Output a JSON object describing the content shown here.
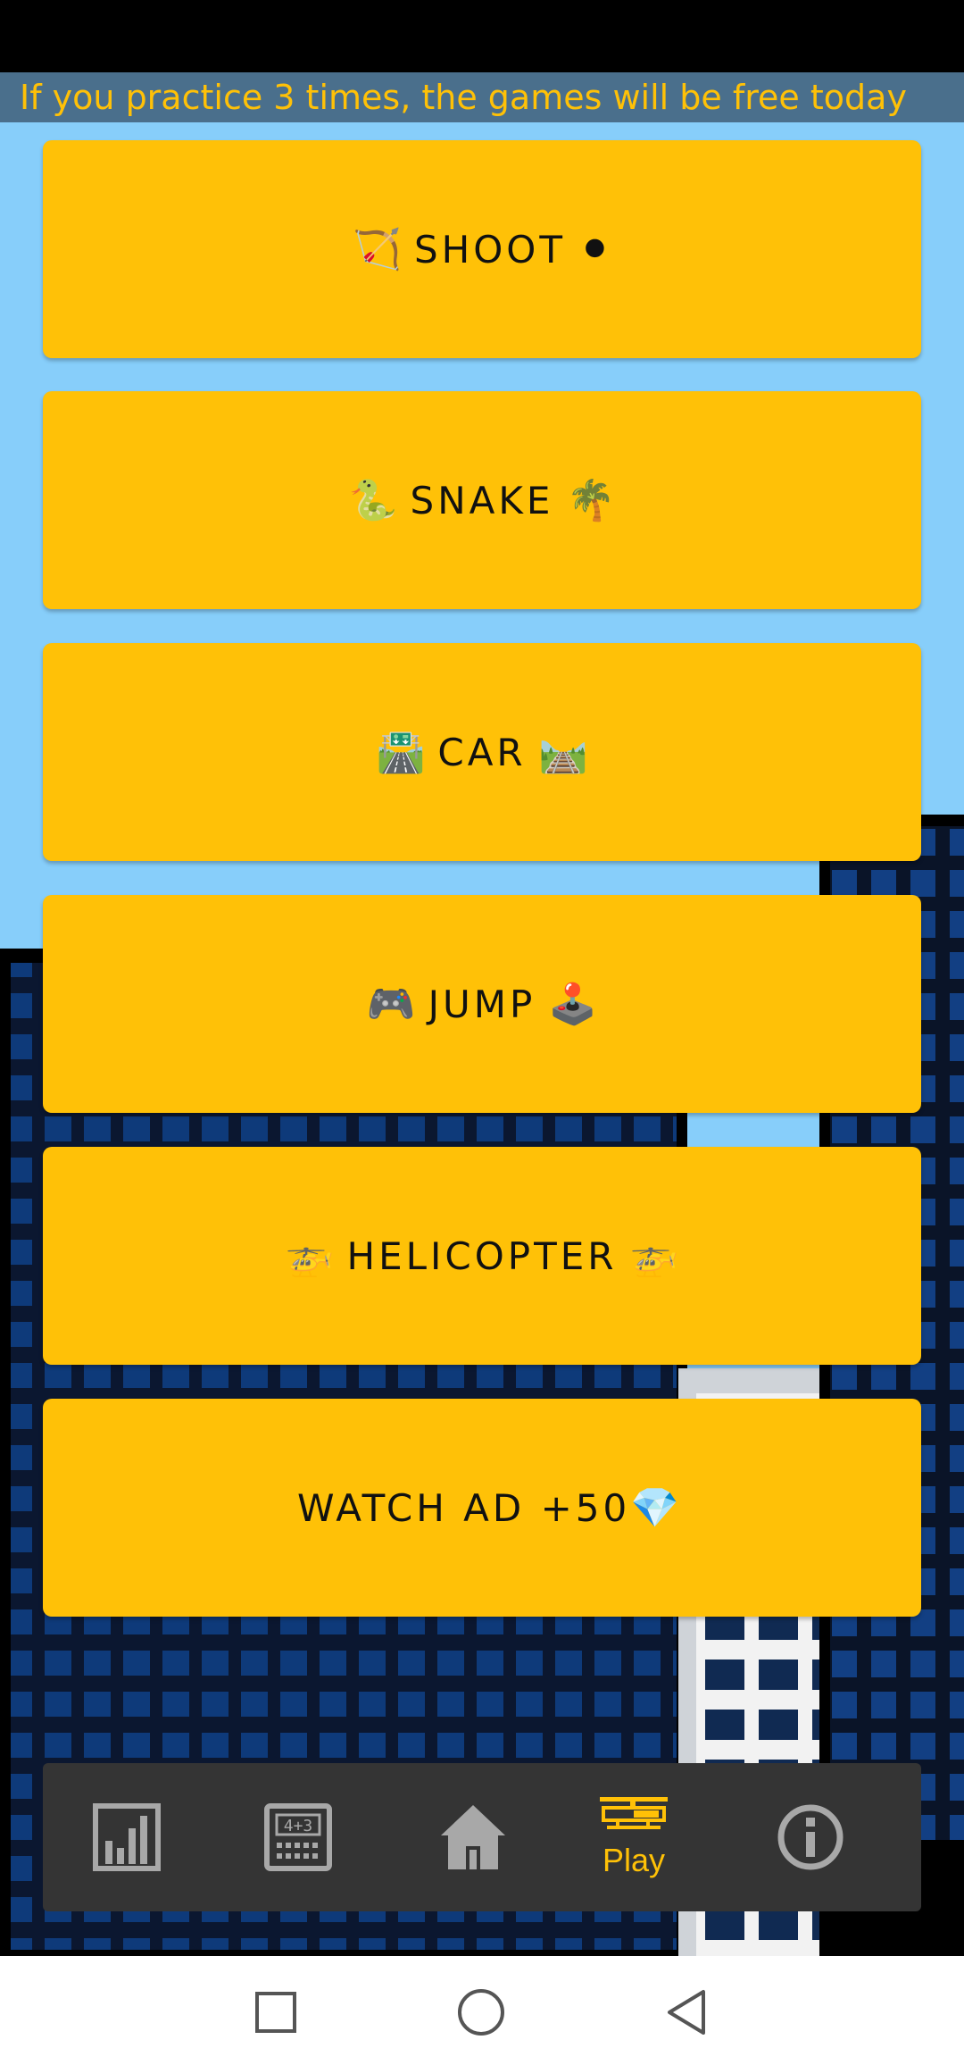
{
  "banner": {
    "text": "If you practice 3 times, the games will be free today"
  },
  "menu": [
    {
      "id": "shoot",
      "label": "SHOOT",
      "emoji_left": "🏹",
      "emoji_right": "⚫"
    },
    {
      "id": "snake",
      "label": "SNAKE",
      "emoji_left": "🐍",
      "emoji_right": "🌴"
    },
    {
      "id": "car",
      "label": "CAR",
      "emoji_left": "🛣️",
      "emoji_right": "🛤️"
    },
    {
      "id": "jump",
      "label": "JUMP",
      "emoji_left": "🎮",
      "emoji_right": "🕹️"
    },
    {
      "id": "helicopter",
      "label": "HELICOPTER",
      "emoji_left": "🚁",
      "emoji_right": "🚁"
    },
    {
      "id": "watch-ad",
      "label": "WATCH AD +50",
      "emoji_left": "",
      "emoji_right": "💎"
    }
  ],
  "bottom_nav": {
    "items": [
      {
        "icon": "bar-chart-icon",
        "label": ""
      },
      {
        "icon": "calculator-icon",
        "label": ""
      },
      {
        "icon": "home-icon",
        "label": ""
      },
      {
        "icon": "helicopter-icon",
        "label": "Play",
        "active": true
      },
      {
        "icon": "info-icon",
        "label": ""
      }
    ]
  },
  "colors": {
    "sky": "#87CEFA",
    "accent": "#FFC107",
    "nav_bg": "#343434",
    "building_dark": "#0b1730",
    "window_blue": "#0e3a7a"
  },
  "system_nav": {
    "icons": [
      "square-recents-icon",
      "circle-home-icon",
      "triangle-back-icon"
    ]
  }
}
